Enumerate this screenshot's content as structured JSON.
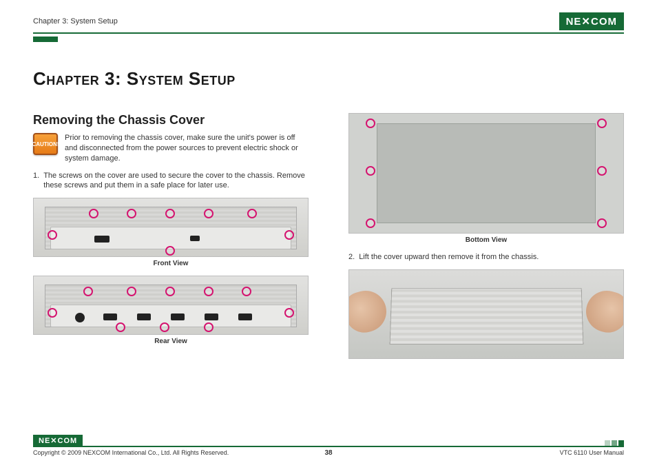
{
  "header": {
    "breadcrumb": "Chapter 3: System Setup",
    "logo_text": "NE✕COM"
  },
  "chapter_title": "Chapter 3: System Setup",
  "left": {
    "section_title": "Removing the Chassis Cover",
    "caution_label": "CAUTION!",
    "caution_text": "Prior to removing the chassis cover, make sure the unit's power is off and disconnected from the power sources to prevent electric shock or system damage.",
    "step1_num": "1.",
    "step1_text": "The screws on the cover are used to secure the cover to the chassis. Remove these screws and put them in a safe place for later use.",
    "caption_front": "Front View",
    "caption_rear": "Rear View"
  },
  "right": {
    "caption_bottom": "Bottom View",
    "step2_num": "2.",
    "step2_text": "Lift the cover upward then remove it from the chassis."
  },
  "footer": {
    "logo_text": "NE✕COM",
    "copyright": "Copyright © 2009 NEXCOM International Co., Ltd. All Rights Reserved.",
    "page_number": "38",
    "manual_ref": "VTC 6110 User Manual"
  }
}
